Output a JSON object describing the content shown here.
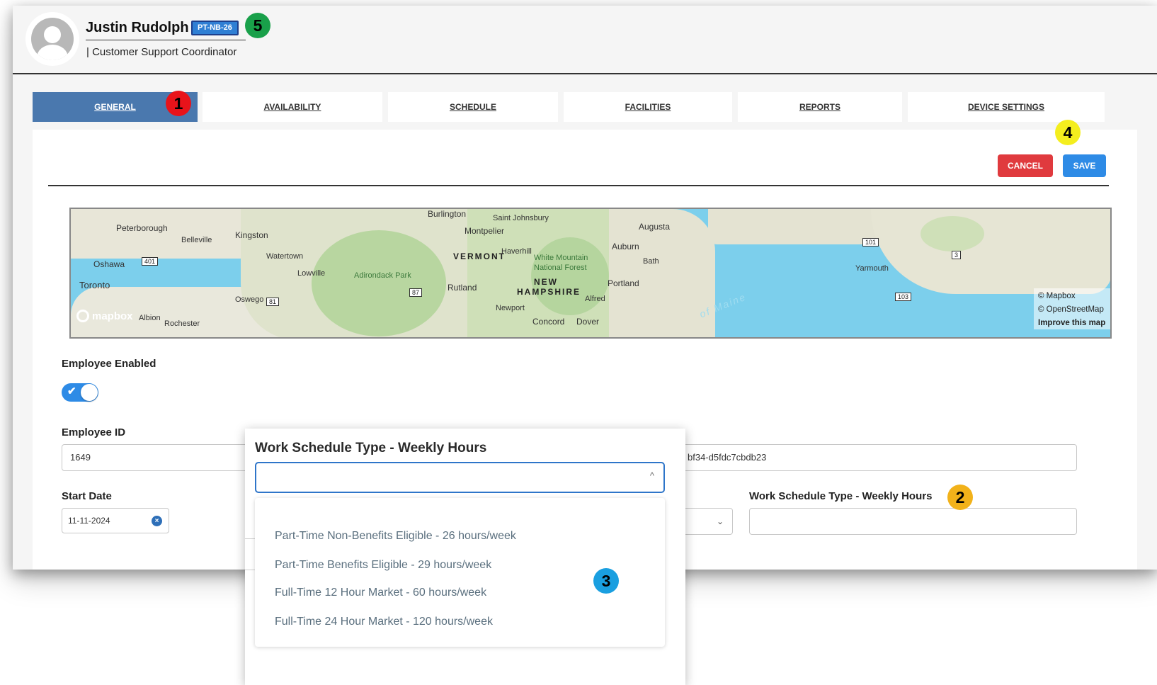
{
  "employee": {
    "name": "Justin Rudolph",
    "badge": "PT-NB-26",
    "title": "| Customer Support Coordinator"
  },
  "tabs": [
    {
      "label": "GENERAL",
      "active": true
    },
    {
      "label": "AVAILABILITY"
    },
    {
      "label": "SCHEDULE"
    },
    {
      "label": "FACILITIES"
    },
    {
      "label": "REPORTS"
    },
    {
      "label": "DEVICE SETTINGS"
    }
  ],
  "actions": {
    "cancel_label": "CANCEL",
    "save_label": "SAVE"
  },
  "map": {
    "labels": {
      "peterborough": "Peterborough",
      "belleville": "Belleville",
      "kingston": "Kingston",
      "oshawa": "Oshawa",
      "toronto": "Toronto",
      "watertown": "Watertown",
      "lowville": "Lowville",
      "oswego": "Oswego",
      "albion": "Albion",
      "rochester": "Rochester",
      "adirondack": "Adirondack Park",
      "burlington": "Burlington",
      "saint_johnsbury": "Saint Johnsbury",
      "montpelier": "Montpelier",
      "vermont": "VERMONT",
      "haverhill": "Haverhill",
      "white_mountain": "White Mountain",
      "national_forest": "National Forest",
      "new": "NEW",
      "hampshire": "HAMPSHIRE",
      "rutland": "Rutland",
      "newport": "Newport",
      "concord": "Concord",
      "dover": "Dover",
      "alfred": "Alfred",
      "portland": "Portland",
      "bath": "Bath",
      "auburn": "Auburn",
      "augusta": "Augusta",
      "yarmouth": "Yarmouth",
      "gulf": "of Maine"
    },
    "shields": {
      "s401": "401",
      "s81": "81",
      "s87": "87",
      "s101": "101",
      "s3": "3",
      "s103": "103"
    },
    "attribution": {
      "mapbox": "© Mapbox",
      "osm": "© OpenStreetMap",
      "improve": "Improve this map"
    },
    "logo": "mapbox"
  },
  "form": {
    "employee_enabled_label": "Employee Enabled",
    "employee_enabled": true,
    "employee_id_label": "Employee ID",
    "employee_id_value": "1649",
    "uuid_partial_value": "bf34-d5fdc7cbdb23",
    "start_date_label": "Start Date",
    "start_date_value": "11-11-2024",
    "work_schedule_label": "Work Schedule Type - Weekly Hours",
    "work_schedule_value": ""
  },
  "popup": {
    "title": "Work Schedule Type - Weekly Hours",
    "options": [
      "Part-Time Non-Benefits Eligible - 26 hours/week",
      "Part-Time Benefits Eligible - 29 hours/week",
      "Full-Time 12 Hour Market - 60 hours/week",
      "Full-Time 24 Hour Market - 120 hours/week"
    ]
  },
  "markers": [
    {
      "num": "1",
      "color": "#e8131a"
    },
    {
      "num": "2",
      "color": "#f2b21a"
    },
    {
      "num": "3",
      "color": "#1a9fe0"
    },
    {
      "num": "4",
      "color": "#f4ee1e"
    },
    {
      "num": "5",
      "color": "#19a04a"
    }
  ]
}
